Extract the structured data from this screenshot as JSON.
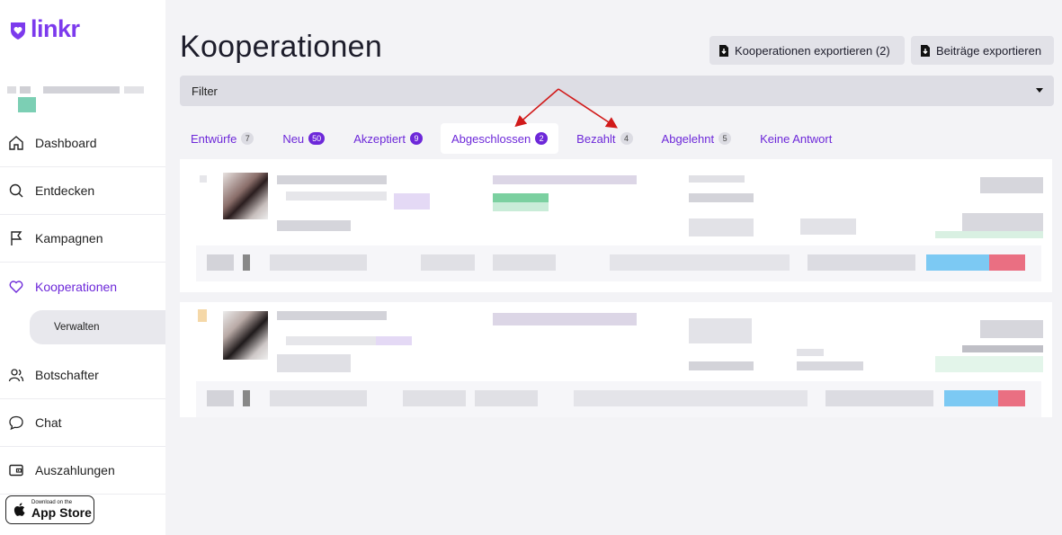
{
  "brand": {
    "name": "linkr",
    "color": "#7c3aed"
  },
  "sidebar": {
    "items": [
      {
        "label": "Dashboard",
        "icon": "home-icon"
      },
      {
        "label": "Entdecken",
        "icon": "search-icon"
      },
      {
        "label": "Kampagnen",
        "icon": "flag-icon"
      },
      {
        "label": "Kooperationen",
        "icon": "heart-icon",
        "active": true
      },
      {
        "label": "Botschafter",
        "icon": "users-icon"
      },
      {
        "label": "Chat",
        "icon": "chat-icon"
      },
      {
        "label": "Auszahlungen",
        "icon": "wallet-icon"
      }
    ],
    "subitem": {
      "label": "Verwalten"
    },
    "appstore": {
      "small": "Download on the",
      "big": "App Store"
    }
  },
  "header": {
    "title": "Kooperationen",
    "export_cooperations": "Kooperationen exportieren (2)",
    "export_posts": "Beiträge exportieren"
  },
  "filter": {
    "label": "Filter"
  },
  "tabs": [
    {
      "label": "Entwürfe",
      "count": "7",
      "style": "grey"
    },
    {
      "label": "Neu",
      "count": "50",
      "style": "purple"
    },
    {
      "label": "Akzeptiert",
      "count": "9",
      "style": "purple"
    },
    {
      "label": "Abgeschlossen",
      "count": "2",
      "style": "purple",
      "active": true
    },
    {
      "label": "Bezahlt",
      "count": "4",
      "style": "grey"
    },
    {
      "label": "Abgelehnt",
      "count": "5",
      "style": "grey"
    },
    {
      "label": "Keine Antwort",
      "count": "",
      "style": "none"
    }
  ],
  "colors": {
    "accent": "#6d28d9",
    "annotation_arrow": "#d11a1a"
  }
}
